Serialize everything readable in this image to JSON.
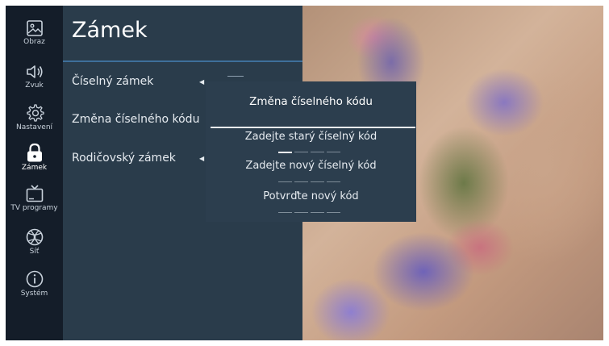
{
  "sidebar": {
    "items": [
      {
        "label": "Obraz",
        "icon": "image-icon"
      },
      {
        "label": "Zvuk",
        "icon": "speaker-icon"
      },
      {
        "label": "Nastavení",
        "icon": "gear-icon"
      },
      {
        "label": "Zámek",
        "icon": "lock-icon",
        "active": true
      },
      {
        "label": "TV programy",
        "icon": "tv-icon"
      },
      {
        "label": "Síť",
        "icon": "globe-icon"
      },
      {
        "label": "Systém",
        "icon": "info-icon"
      }
    ]
  },
  "menu": {
    "title": "Zámek",
    "items": [
      {
        "label": "Číselný zámek",
        "has_arrow": true
      },
      {
        "label": "Změna číselného kódu",
        "has_arrow": false
      },
      {
        "label": "Rodičovský zámek",
        "has_arrow": true
      }
    ]
  },
  "dialog": {
    "title": "Změna číselného kódu",
    "fields": [
      {
        "label": "Zadejte starý číselný kód",
        "digits": 4,
        "focused": true
      },
      {
        "label": "Zadejte nový číselný kód",
        "digits": 4,
        "focused": false
      },
      {
        "label": "Potvrďte nový kód",
        "digits": 4,
        "focused": false
      }
    ]
  },
  "colors": {
    "sidebar_bg": "#141d29",
    "menu_bg": "#2a3c4b",
    "accent_line": "#3e6f9b",
    "dialog_bg": "#2c3e4e"
  }
}
